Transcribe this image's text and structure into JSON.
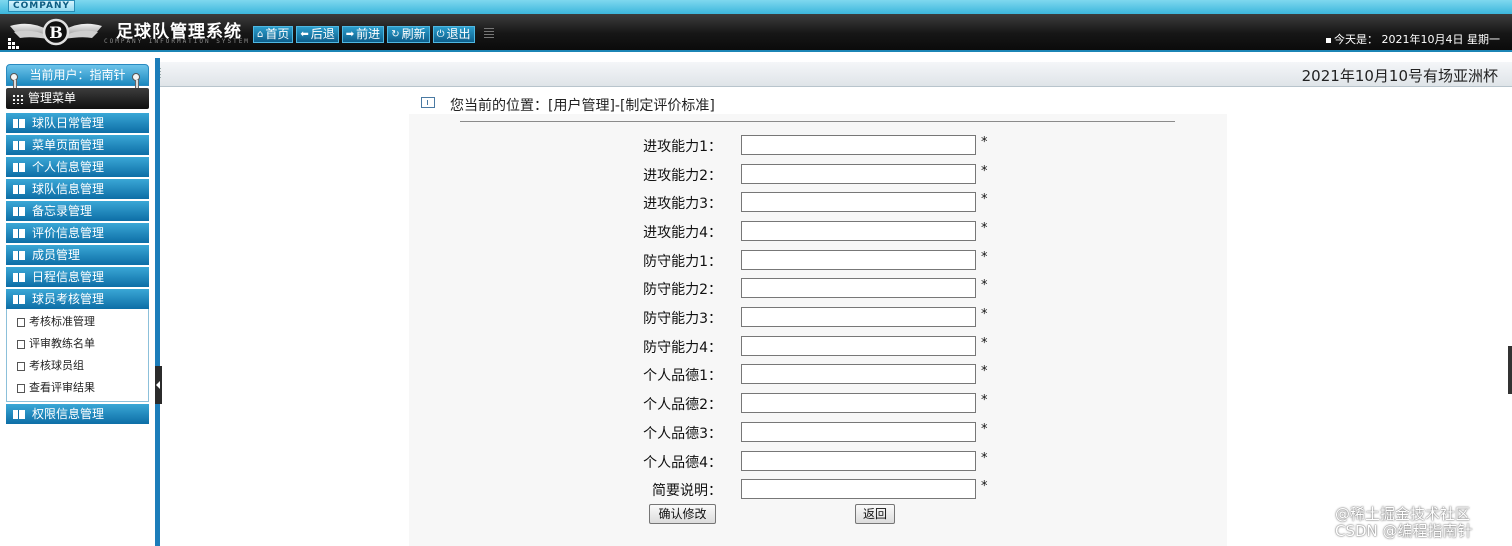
{
  "header": {
    "company_tag": "COMPANY",
    "system_title": "足球队管理系统",
    "system_subtitle": "COMPANY INFORMATION SYSTEM",
    "toolbar": [
      {
        "label": "首页",
        "icon": "home-icon",
        "glyph": "⌂"
      },
      {
        "label": "后退",
        "icon": "arrow-left-icon",
        "glyph": "⬅"
      },
      {
        "label": "前进",
        "icon": "arrow-right-icon",
        "glyph": "➡"
      },
      {
        "label": "刷新",
        "icon": "refresh-icon",
        "glyph": "↻"
      },
      {
        "label": "退出",
        "icon": "power-icon",
        "glyph": "⏻"
      }
    ],
    "today_label": "今天是：",
    "today_value": "2021年10月4日 星期一"
  },
  "subbar": {
    "marquee": "2021年10月10号有场亚洲杯"
  },
  "sidebar": {
    "current_user": "当前用户：指南针",
    "menu_title": "管理菜单",
    "items": [
      {
        "label": "球队日常管理"
      },
      {
        "label": "菜单页面管理"
      },
      {
        "label": "个人信息管理"
      },
      {
        "label": "球队信息管理"
      },
      {
        "label": "备忘录管理"
      },
      {
        "label": "评价信息管理"
      },
      {
        "label": "成员管理"
      },
      {
        "label": "日程信息管理"
      },
      {
        "label": "球员考核管理"
      }
    ],
    "sub_items": [
      {
        "label": "考核标准管理"
      },
      {
        "label": "评审教练名单"
      },
      {
        "label": "考核球员组"
      },
      {
        "label": "查看评审结果"
      }
    ],
    "last_item": {
      "label": "权限信息管理"
    }
  },
  "main": {
    "breadcrumb": "您当前的位置：[用户管理]-[制定评价标准]",
    "fields": [
      {
        "label": "进攻能力1：",
        "value": "",
        "required": "*"
      },
      {
        "label": "进攻能力2：",
        "value": "",
        "required": "*"
      },
      {
        "label": "进攻能力3：",
        "value": "",
        "required": "*"
      },
      {
        "label": "进攻能力4：",
        "value": "",
        "required": "*"
      },
      {
        "label": "防守能力1：",
        "value": "",
        "required": "*"
      },
      {
        "label": "防守能力2：",
        "value": "",
        "required": "*"
      },
      {
        "label": "防守能力3：",
        "value": "",
        "required": "*"
      },
      {
        "label": "防守能力4：",
        "value": "",
        "required": "*"
      },
      {
        "label": "个人品德1：",
        "value": "",
        "required": "*"
      },
      {
        "label": "个人品德2：",
        "value": "",
        "required": "*"
      },
      {
        "label": "个人品德3：",
        "value": "",
        "required": "*"
      },
      {
        "label": "个人品德4：",
        "value": "",
        "required": "*"
      },
      {
        "label": "简要说明：",
        "value": "",
        "required": "*"
      }
    ],
    "confirm_label": "确认修改",
    "back_label": "返回"
  },
  "watermark": {
    "line1": "@稀土掘金技术社区",
    "line2": "CSDN @编程指南针"
  },
  "colors": {
    "accent": "#1b88bf",
    "header_bg": "#161616",
    "menu_item": "#0d6ea6"
  }
}
